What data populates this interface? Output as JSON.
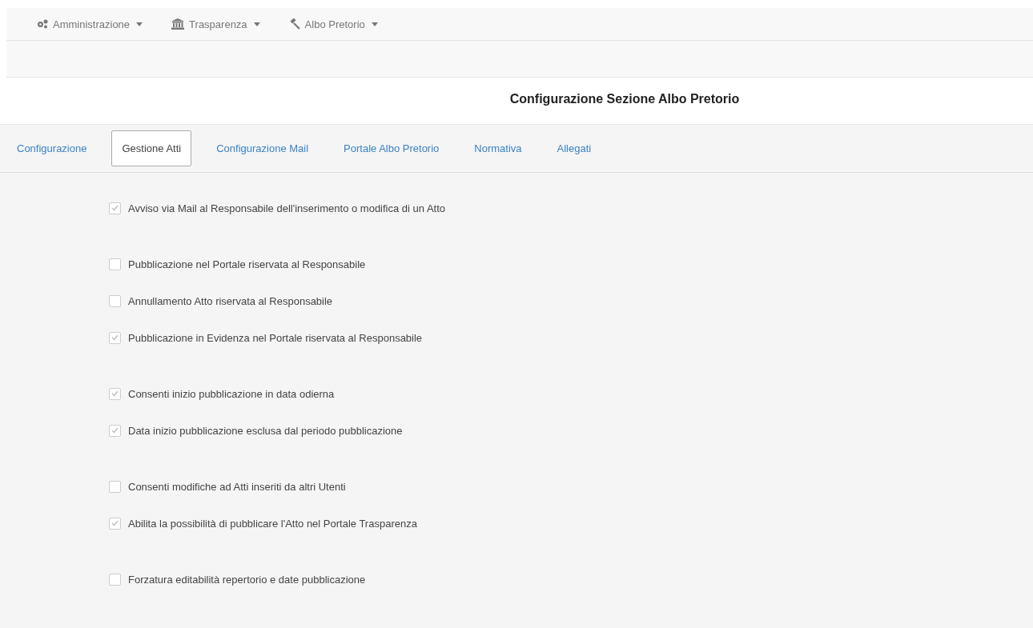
{
  "navbar": {
    "menus": [
      {
        "label": "Amministrazione"
      },
      {
        "label": "Trasparenza"
      },
      {
        "label": "Albo Pretorio"
      }
    ]
  },
  "page_title": "Configurazione Sezione Albo Pretorio",
  "tabs": [
    {
      "label": "Configurazione",
      "selected": false
    },
    {
      "label": "Gestione Atti",
      "selected": true
    },
    {
      "label": "Configurazione Mail",
      "selected": false
    },
    {
      "label": "Portale Albo Pretorio",
      "selected": false
    },
    {
      "label": "Normativa",
      "selected": false
    },
    {
      "label": "Allegati",
      "selected": false
    }
  ],
  "option_groups": [
    {
      "options": [
        {
          "label": "Avviso via Mail al Responsabile dell'inserimento o modifica di un Atto",
          "checked": true
        }
      ]
    },
    {
      "options": [
        {
          "label": "Pubblicazione nel Portale riservata al Responsabile",
          "checked": false
        },
        {
          "label": "Annullamento Atto riservata al Responsabile",
          "checked": false
        },
        {
          "label": "Pubblicazione in Evidenza nel Portale riservata al Responsabile",
          "checked": true
        }
      ]
    },
    {
      "options": [
        {
          "label": "Consenti inizio pubblicazione in data odierna",
          "checked": true
        },
        {
          "label": "Data inizio pubblicazione esclusa dal periodo pubblicazione",
          "checked": true
        }
      ]
    },
    {
      "options": [
        {
          "label": "Consenti modifiche ad Atti inseriti da altri Utenti",
          "checked": false
        },
        {
          "label": "Abilita la possibilità di pubblicare l'Atto nel Portale Trasparenza",
          "checked": true
        }
      ]
    },
    {
      "options": [
        {
          "label": "Forzatura editabilità repertorio e date pubblicazione",
          "checked": false
        }
      ]
    }
  ]
}
